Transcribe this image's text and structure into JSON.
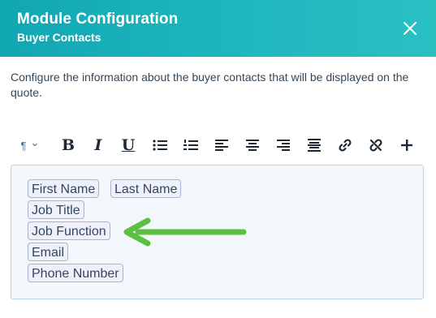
{
  "header": {
    "title": "Module Configuration",
    "subtitle": "Buyer Contacts",
    "close_icon": "close-icon",
    "background": "#1fb6bd"
  },
  "description": "Configure the information about the buyer contacts that will be displayed on the quote.",
  "toolbar": {
    "paragraph": "¶",
    "paragraph_caret": "⌄",
    "bold": "B",
    "italic": "I",
    "underline": "U",
    "more": "+",
    "icons": [
      "paragraph-icon",
      "bold-icon",
      "italic-icon",
      "underline-icon",
      "bulleted-list-icon",
      "numbered-list-icon",
      "align-left-icon",
      "align-center-icon",
      "align-right-icon",
      "justify-icon",
      "link-icon",
      "unlink-icon",
      "plus-icon"
    ]
  },
  "editor": {
    "tokens": [
      "First Name",
      "Last Name",
      "Job Title",
      "Job Function",
      "Email",
      "Phone Number"
    ]
  },
  "annotation": {
    "arrow_color": "#5ec042"
  }
}
